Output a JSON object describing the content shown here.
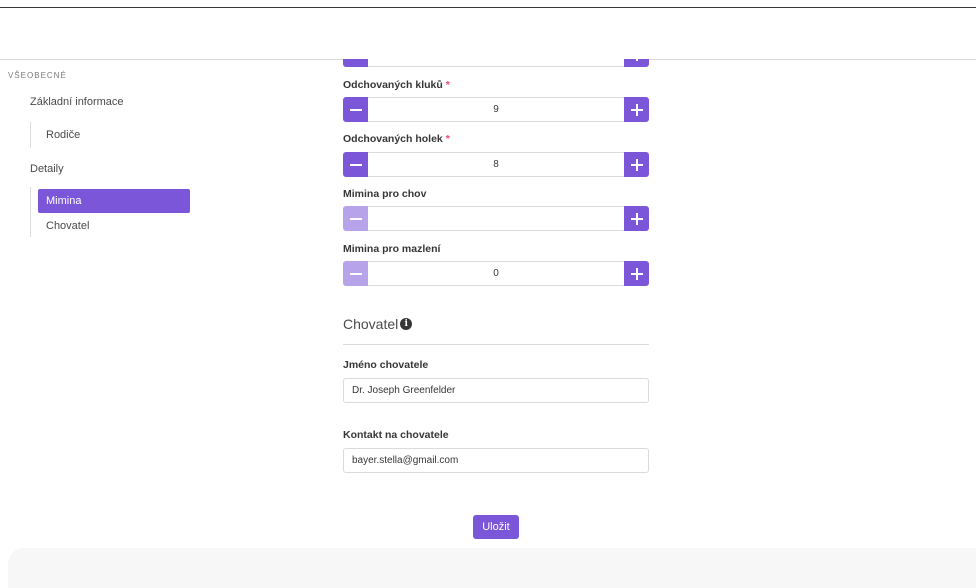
{
  "sidebar": {
    "section_label": "VŠEOBECNÉ",
    "items": [
      {
        "label": "Základní informace"
      },
      {
        "label": "Rodiče"
      },
      {
        "label": "Detaily"
      },
      {
        "label": "Mimina"
      },
      {
        "label": "Chovatel"
      }
    ]
  },
  "form": {
    "boys": {
      "label": "Odchovaných kluků",
      "required_mark": "*",
      "value": "9"
    },
    "girls": {
      "label": "Odchovaných holek",
      "required_mark": "*",
      "value": "8"
    },
    "breeding": {
      "label": "Mimina pro chov",
      "value": ""
    },
    "pets": {
      "label": "Mimina pro mazlení",
      "value": "0"
    }
  },
  "breeder": {
    "title": "Chovatel",
    "info_icon": "info-circle-icon",
    "name_label": "Jméno chovatele",
    "name_value": "Dr. Joseph Greenfelder",
    "contact_label": "Kontakt na chovatele",
    "contact_value": "bayer.stella@gmail.com"
  },
  "actions": {
    "save_label": "Uložit"
  },
  "colors": {
    "accent": "#7b56d9",
    "accent_disabled": "#b7a3ea",
    "required": "#f14668"
  }
}
